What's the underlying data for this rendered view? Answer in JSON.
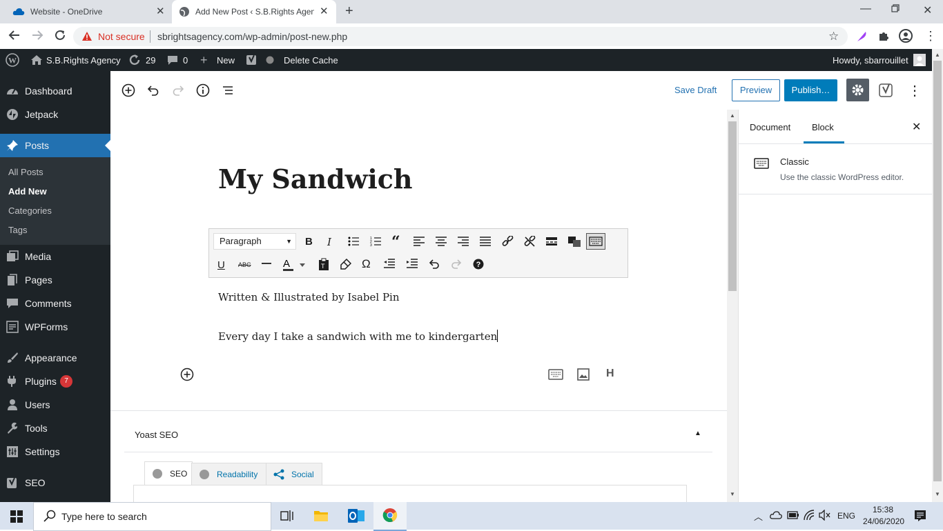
{
  "browser": {
    "tabs": [
      {
        "title": "Website - OneDrive"
      },
      {
        "title": "Add New Post ‹ S.B.Rights Agency"
      }
    ],
    "security": "Not secure",
    "url": "sbrightsagency.com/wp-admin/post-new.php"
  },
  "adminbar": {
    "site": "S.B.Rights Agency",
    "updates": "29",
    "comments": "0",
    "new": "New",
    "cache": "Delete Cache",
    "howdy": "Howdy, sbarrouillet"
  },
  "sidebar": {
    "items": [
      {
        "label": "Dashboard",
        "icon": "dashboard-icon"
      },
      {
        "label": "Jetpack",
        "icon": "jetpack-icon"
      },
      {
        "label": "Posts",
        "icon": "pin-icon"
      },
      {
        "label": "Media",
        "icon": "media-icon"
      },
      {
        "label": "Pages",
        "icon": "pages-icon"
      },
      {
        "label": "Comments",
        "icon": "comments-icon"
      },
      {
        "label": "WPForms",
        "icon": "wpforms-icon"
      },
      {
        "label": "Appearance",
        "icon": "brush-icon"
      },
      {
        "label": "Plugins",
        "icon": "plugin-icon"
      },
      {
        "label": "Users",
        "icon": "users-icon"
      },
      {
        "label": "Tools",
        "icon": "wrench-icon"
      },
      {
        "label": "Settings",
        "icon": "settings-icon"
      },
      {
        "label": "SEO",
        "icon": "yoast-icon"
      }
    ],
    "plugins_badge": "7",
    "posts_sub": [
      "All Posts",
      "Add New",
      "Categories",
      "Tags"
    ]
  },
  "editor": {
    "save_draft": "Save Draft",
    "preview": "Preview",
    "publish": "Publish…",
    "title": "My Sandwich",
    "format_select": "Paragraph",
    "paragraphs": [
      "Written & Illustrated by Isabel Pin",
      "Every day I take a sandwich with me to kindergarten"
    ]
  },
  "panel": {
    "tab_document": "Document",
    "tab_block": "Block",
    "block_name": "Classic",
    "block_desc": "Use the classic WordPress editor."
  },
  "yoast": {
    "title": "Yoast SEO",
    "tabs": [
      "SEO",
      "Readability",
      "Social"
    ]
  },
  "taskbar": {
    "search_placeholder": "Type here to search",
    "lang": "ENG",
    "time": "15:38",
    "date": "24/06/2020"
  },
  "colors": {
    "wp_dark": "#1d2327",
    "wp_blue": "#2271b1",
    "publish_blue": "#007cba",
    "badge_red": "#d63638"
  }
}
